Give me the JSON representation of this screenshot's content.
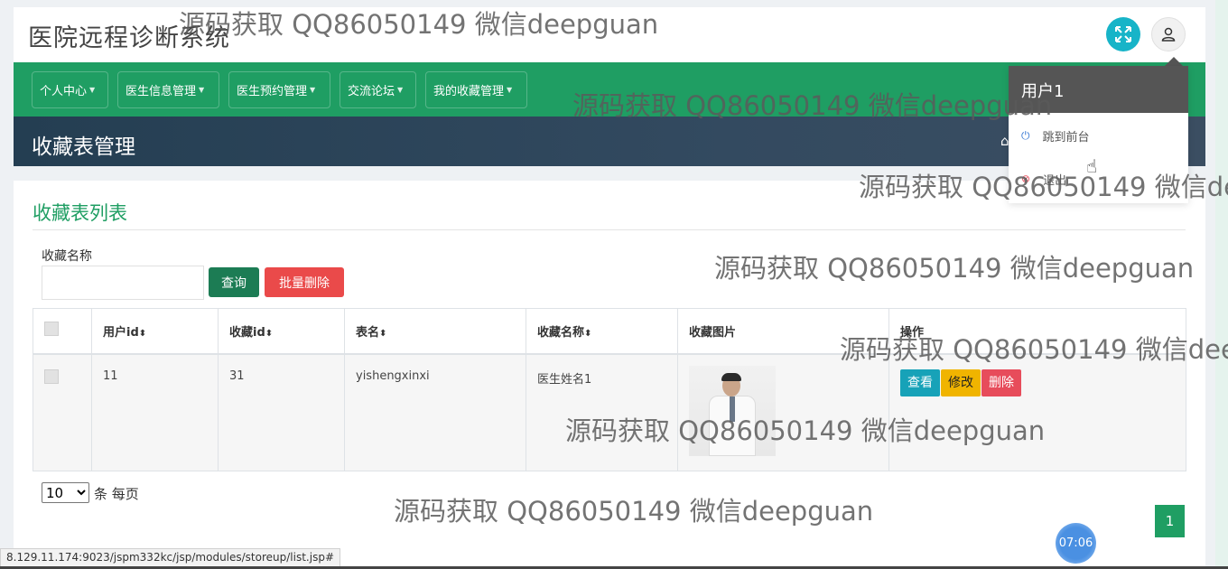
{
  "app": {
    "title": "医院远程诊断系统"
  },
  "header": {
    "fullscreen_icon": "expand-arrows-icon",
    "user_icon": "user-icon"
  },
  "nav": {
    "items": [
      {
        "label": "个人中心"
      },
      {
        "label": "医生信息管理"
      },
      {
        "label": "医生预约管理"
      },
      {
        "label": "交流论坛"
      },
      {
        "label": "我的收藏管理"
      }
    ]
  },
  "page": {
    "title": "收藏表管理",
    "home_icon": "home-icon"
  },
  "card": {
    "title": "收藏表列表",
    "search": {
      "label": "收藏名称",
      "value": "",
      "placeholder": ""
    },
    "buttons": {
      "query": "查询",
      "batch_delete": "批量删除"
    }
  },
  "table": {
    "sort_icon": "⬍",
    "headers": [
      "用户id",
      "收藏id",
      "表名",
      "收藏名称",
      "收藏图片",
      "操作"
    ],
    "rows": [
      {
        "user_id": "11",
        "fav_id": "31",
        "table_name": "yishengxinxi",
        "fav_name": "医生姓名1",
        "image_desc": "doctor-in-white-coat-photo",
        "actions": {
          "view": "查看",
          "edit": "修改",
          "delete": "删除"
        }
      }
    ]
  },
  "pagination": {
    "page_size": "10",
    "page_size_options": [
      "10"
    ],
    "page_size_label": "条 每页",
    "current_page": "1"
  },
  "user_dropdown": {
    "username": "用户1",
    "items": [
      {
        "label": "跳到前台",
        "icon": "power-icon"
      },
      {
        "label": "退出",
        "icon": "logout-icon"
      }
    ]
  },
  "status_bar": {
    "url": "8.129.11.174:9023/jspm332kc/jsp/modules/storeup/list.jsp#"
  },
  "clock": {
    "time": "07:06"
  },
  "watermark": {
    "text": "源码获取 QQ86050149 微信deepguan"
  },
  "colors": {
    "primary_green": "#1f9e63",
    "header_dark": "#2d4358",
    "cyan": "#17a2b8",
    "yellow": "#f0b400",
    "red": "#e74c5b"
  }
}
